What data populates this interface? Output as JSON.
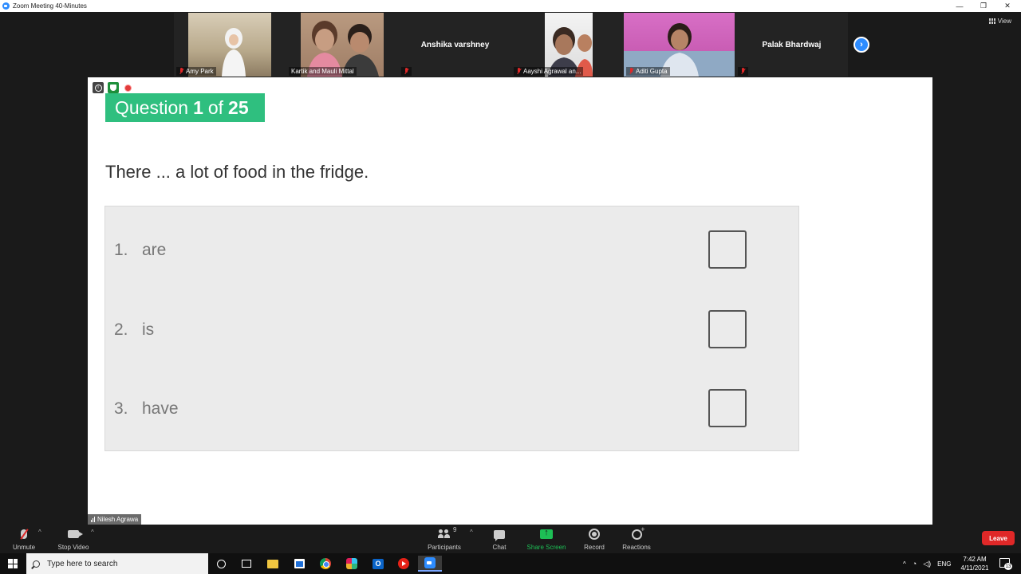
{
  "window": {
    "title": "Zoom Meeting 40-Minutes",
    "controls": {
      "minimize": "—",
      "restore": "❐",
      "close": "✕"
    }
  },
  "view_button": {
    "label": "View"
  },
  "participants_strip": [
    {
      "name": "Amy Park",
      "has_video": true,
      "muted": true
    },
    {
      "name": "Kartik and Mauli Mittal",
      "has_video": true,
      "muted": false
    },
    {
      "name": "Anshika varshney",
      "has_video": false,
      "muted": true
    },
    {
      "name": "Aayshi Agrawal an...",
      "has_video": true,
      "muted": true
    },
    {
      "name": "Aditi Gupta",
      "has_video": true,
      "muted": true
    },
    {
      "name": "Palak  Bhardwaj",
      "has_video": false,
      "muted": true
    }
  ],
  "next_page": {
    "icon": "chevron-right-icon",
    "glyph": "›"
  },
  "shared_screen": {
    "question_banner": {
      "prefix": "Question",
      "current": "1",
      "sep": "of",
      "total": "25"
    },
    "question_text": "There ... a lot of food in the fridge.",
    "options": [
      {
        "num": "1.",
        "text": "are"
      },
      {
        "num": "2.",
        "text": "is"
      },
      {
        "num": "3.",
        "text": "have"
      }
    ]
  },
  "presenter_tag": {
    "name": "Nilesh Agrawa"
  },
  "toolbar": {
    "unmute": "Unmute",
    "stop_video": "Stop Video",
    "participants": "Participants",
    "participants_count": "9",
    "chat": "Chat",
    "share_screen": "Share Screen",
    "record": "Record",
    "reactions": "Reactions",
    "leave": "Leave",
    "caret": "^"
  },
  "taskbar": {
    "search_placeholder": "Type here to search",
    "tray_caret": "^",
    "language": "ENG",
    "time": "7:42 AM",
    "date": "4/11/2021",
    "notification_count": "13"
  },
  "colors": {
    "question_banner": "#2fbf7f",
    "leave": "#e02828",
    "share_screen": "#1dbf55",
    "zoom_blue": "#2d8cff"
  }
}
